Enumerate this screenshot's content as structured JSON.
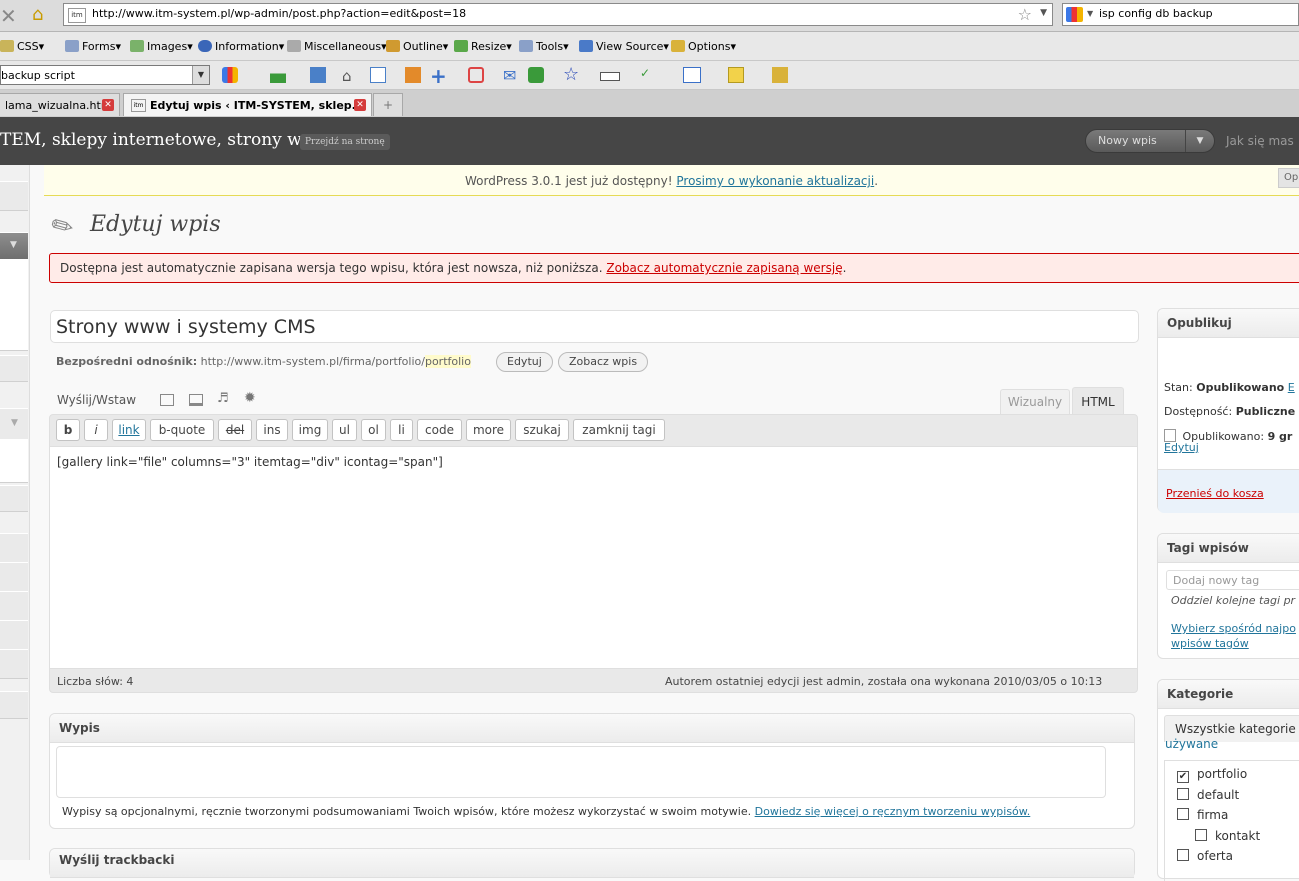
{
  "browser": {
    "url": "http://www.itm-system.pl/wp-admin/post.php?action=edit&post=18",
    "search_value": "isp config db backup",
    "toolbar1": [
      "CSS",
      "Forms",
      "Images",
      "Information",
      "Miscellaneous",
      "Outline",
      "Resize",
      "Tools",
      "View Source",
      "Options"
    ],
    "toolbar2_value": "backup script",
    "tabs": [
      "lama_wizualna.html",
      "Edytuj wpis ‹ ITM-SYSTEM, sklep..."
    ]
  },
  "wp_header": {
    "site_title": "TEM, sklepy internetowe, strony w...",
    "visit_site": "Przejdź na stronę",
    "new_post": "Nowy wpis",
    "howdy": "Jak się mas"
  },
  "update_notice": {
    "text": "WordPress 3.0.1 jest już dostępny!",
    "link": "Prosimy o wykonanie aktualizacji",
    "suffix": ".",
    "screen_options": "Op"
  },
  "page_title": "Edytuj wpis",
  "autosave": {
    "text": "Dostępna jest automatycznie zapisana wersja tego wpisu, która jest nowsza, niż poniższa.",
    "link": "Zobacz automatycznie zapisaną wersję",
    "suffix": "."
  },
  "post": {
    "title": "Strony www i systemy CMS",
    "permalink_label": "Bezpośredni odnośnik:",
    "permalink_base": "http://www.itm-system.pl/firma/portfolio/",
    "permalink_slug": "portfolio",
    "edit_button": "Edytuj",
    "view_button": "Zobacz wpis"
  },
  "editor": {
    "upload_label": "Wyślij/Wstaw",
    "tab_visual": "Wizualny",
    "tab_html": "HTML",
    "quicktags": [
      "b",
      "i",
      "link",
      "b-quote",
      "del",
      "ins",
      "img",
      "ul",
      "ol",
      "li",
      "code",
      "more",
      "szukaj",
      "zamknij tagi"
    ],
    "content": "[gallery link=\"file\" columns=\"3\" itemtag=\"div\" icontag=\"span\"]",
    "word_count": "Liczba słów: 4",
    "last_edit": "Autorem ostatniej edycji jest admin, została ona wykonana 2010/03/05 o 10:13"
  },
  "excerpt": {
    "title": "Wypis",
    "help": "Wypisy są opcjonalnymi, ręcznie tworzonymi podsumowaniami Twoich wpisów, które możesz wykorzystać w swoim motywie.",
    "help_link": "Dowiedz się więcej o ręcznym tworzeniu wypisów."
  },
  "publish": {
    "title": "Opublikuj",
    "status_label": "Stan:",
    "status_value": "Opublikowano",
    "status_edit": "E",
    "visibility_label": "Dostępność:",
    "visibility_value": "Publiczne",
    "published_label": "Opublikowano:",
    "published_value": "9 gr",
    "edit_link": "Edytuj",
    "trash": "Przenieś do kosza"
  },
  "tags": {
    "title": "Tagi wpisów",
    "placeholder": "Dodaj nowy tag",
    "hint": "Oddziel kolejne tagi pr",
    "choose_link_1": "Wybierz spośród najpo",
    "choose_link_2": "wpisów tagów"
  },
  "categories": {
    "title": "Kategorie",
    "tab_all": "Wszystkie kategorie",
    "tab_used": "używane",
    "items": [
      {
        "label": "portfolio",
        "checked": "✔"
      },
      {
        "label": "default",
        "checked": ""
      },
      {
        "label": "firma",
        "checked": ""
      },
      {
        "label": "kontakt",
        "checked": ""
      },
      {
        "label": "oferta",
        "checked": ""
      }
    ]
  },
  "bottom_box_title": "Wyślij trackbacki"
}
